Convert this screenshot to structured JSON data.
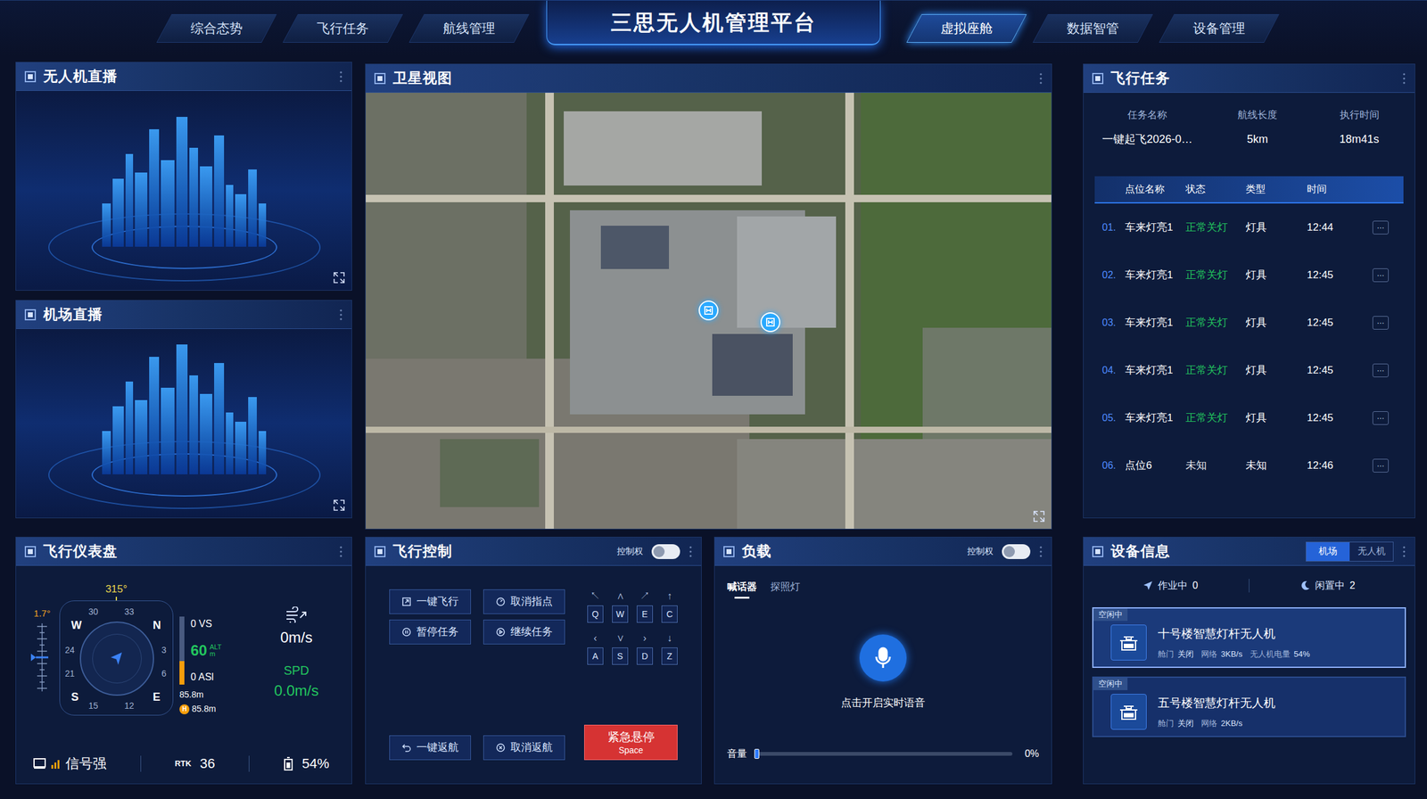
{
  "header": {
    "title": "三思无人机管理平台",
    "nav_left": [
      {
        "label": "综合态势",
        "selected": false
      },
      {
        "label": "飞行任务",
        "selected": false
      },
      {
        "label": "航线管理",
        "selected": false
      }
    ],
    "nav_right": [
      {
        "label": "虚拟座舱",
        "selected": true
      },
      {
        "label": "数据智管",
        "selected": false
      },
      {
        "label": "设备管理",
        "selected": false
      }
    ]
  },
  "drone_live": {
    "title": "无人机直播"
  },
  "dock_live": {
    "title": "机场直播"
  },
  "satellite": {
    "title": "卫星视图",
    "pins": [
      {
        "kind": "dock"
      },
      {
        "kind": "dock"
      }
    ]
  },
  "instruments": {
    "title": "飞行仪表盘",
    "pitch": "1.7°",
    "heading": "315°",
    "compass_labels": [
      "30",
      "33",
      "W",
      "N",
      "24",
      "3",
      "21",
      "6",
      "S",
      "E",
      "15",
      "12"
    ],
    "vs": "0 VS",
    "alt_value": "60",
    "alt_label": "ALT",
    "alt_unit": "m",
    "asl": "0 ASl",
    "alt_level": 0.35,
    "height1": "85.8m",
    "home_mark": "H",
    "height2": "85.8m",
    "wind": "0m/s",
    "spd_label": "SPD",
    "spd": "0.0m/s",
    "signal": "信号强",
    "rtk_label": "RTK",
    "rtk": "36",
    "battery": "54%"
  },
  "flight_control": {
    "title": "飞行控制",
    "control_label": "控制权",
    "control_on": false,
    "buttons": [
      {
        "label": "一键飞行",
        "kind": "takeoff"
      },
      {
        "label": "取消指点",
        "kind": "cancel-point"
      },
      {
        "label": "暂停任务",
        "kind": "pause"
      },
      {
        "label": "继续任务",
        "kind": "resume"
      }
    ],
    "keys": [
      {
        "arrow": "↖",
        "key": "Q"
      },
      {
        "arrow": "∧",
        "key": "W"
      },
      {
        "arrow": "↗",
        "key": "E"
      },
      {
        "arrow": "↑",
        "key": "C"
      },
      {
        "arrow": "‹",
        "key": "A"
      },
      {
        "arrow": "∨",
        "key": "S"
      },
      {
        "arrow": "›",
        "key": "D"
      },
      {
        "arrow": "↓",
        "key": "Z"
      }
    ],
    "return_buttons": [
      {
        "label": "一键返航",
        "kind": "return-home"
      },
      {
        "label": "取消返航",
        "kind": "cancel-return"
      }
    ],
    "emergency": {
      "label": "紧急悬停",
      "hint": "Space"
    }
  },
  "payload": {
    "title": "负载",
    "control_label": "控制权",
    "control_on": false,
    "tabs": [
      {
        "label": "喊话器",
        "selected": true
      },
      {
        "label": "探照灯",
        "selected": false
      }
    ],
    "voice_hint": "点击开启实时语音",
    "volume_label": "音量",
    "volume_level": 0,
    "volume_reading": "0%"
  },
  "task": {
    "title": "飞行任务",
    "summary_columns": [
      "任务名称",
      "航线长度",
      "执行时间"
    ],
    "summary_values": [
      "一键起飞2026-0…",
      "5km",
      "18m41s"
    ],
    "columns": [
      "点位名称",
      "状态",
      "类型",
      "时间"
    ],
    "rows": [
      {
        "index": "01.",
        "name": "车来灯亮1",
        "status": "正常关灯",
        "color": "#22c55e",
        "type": "灯具",
        "time": "12:44",
        "more": "···"
      },
      {
        "index": "02.",
        "name": "车来灯亮1",
        "status": "正常关灯",
        "color": "#22c55e",
        "type": "灯具",
        "time": "12:45",
        "more": "···"
      },
      {
        "index": "03.",
        "name": "车来灯亮1",
        "status": "正常关灯",
        "color": "#22c55e",
        "type": "灯具",
        "time": "12:45",
        "more": "···"
      },
      {
        "index": "04.",
        "name": "车来灯亮1",
        "status": "正常关灯",
        "color": "#22c55e",
        "type": "灯具",
        "time": "12:45",
        "more": "···"
      },
      {
        "index": "05.",
        "name": "车来灯亮1",
        "status": "正常关灯",
        "color": "#22c55e",
        "type": "灯具",
        "time": "12:45",
        "more": "···"
      },
      {
        "index": "06.",
        "name": "点位6",
        "status": "未知",
        "color": "#e5e7eb",
        "type": "未知",
        "time": "12:46",
        "more": "···"
      }
    ]
  },
  "devices": {
    "title": "设备信息",
    "tabs": [
      {
        "label": "机场",
        "selected": true
      },
      {
        "label": "无人机",
        "selected": false
      }
    ],
    "working": {
      "label": "作业中",
      "count": "0"
    },
    "idle": {
      "label": "闲置中",
      "count": "2"
    },
    "cards": [
      {
        "badge": "空闲中",
        "name": "十号楼智慧灯杆无人机",
        "selected": true,
        "fields": [
          {
            "label": "舱门",
            "value": "关闭"
          },
          {
            "label": "网络",
            "value": "3KB/s"
          },
          {
            "label": "无人机电量",
            "value": "54%"
          }
        ]
      },
      {
        "badge": "空闲中",
        "name": "五号楼智慧灯杆无人机",
        "selected": false,
        "fields": [
          {
            "label": "舱门",
            "value": "关闭"
          },
          {
            "label": "网络",
            "value": "2KB/s"
          }
        ]
      }
    ]
  }
}
